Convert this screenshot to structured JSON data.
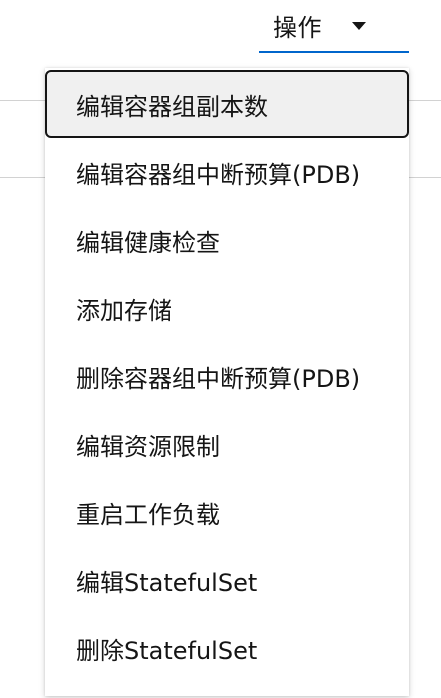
{
  "header": {
    "actions_label": "操作",
    "actions_icon": "caret-down-icon",
    "accent_color": "#0066cc"
  },
  "menu": {
    "items": [
      {
        "label": "编辑容器组副本数",
        "focused": true
      },
      {
        "label": "编辑容器组中断预算(PDB)"
      },
      {
        "label": "编辑健康检查"
      },
      {
        "label": "添加存储"
      },
      {
        "label": "删除容器组中断预算(PDB)"
      },
      {
        "label": "编辑资源限制"
      },
      {
        "label": "重启工作负载"
      },
      {
        "label": "编辑StatefulSet"
      },
      {
        "label": "删除StatefulSet"
      }
    ]
  }
}
